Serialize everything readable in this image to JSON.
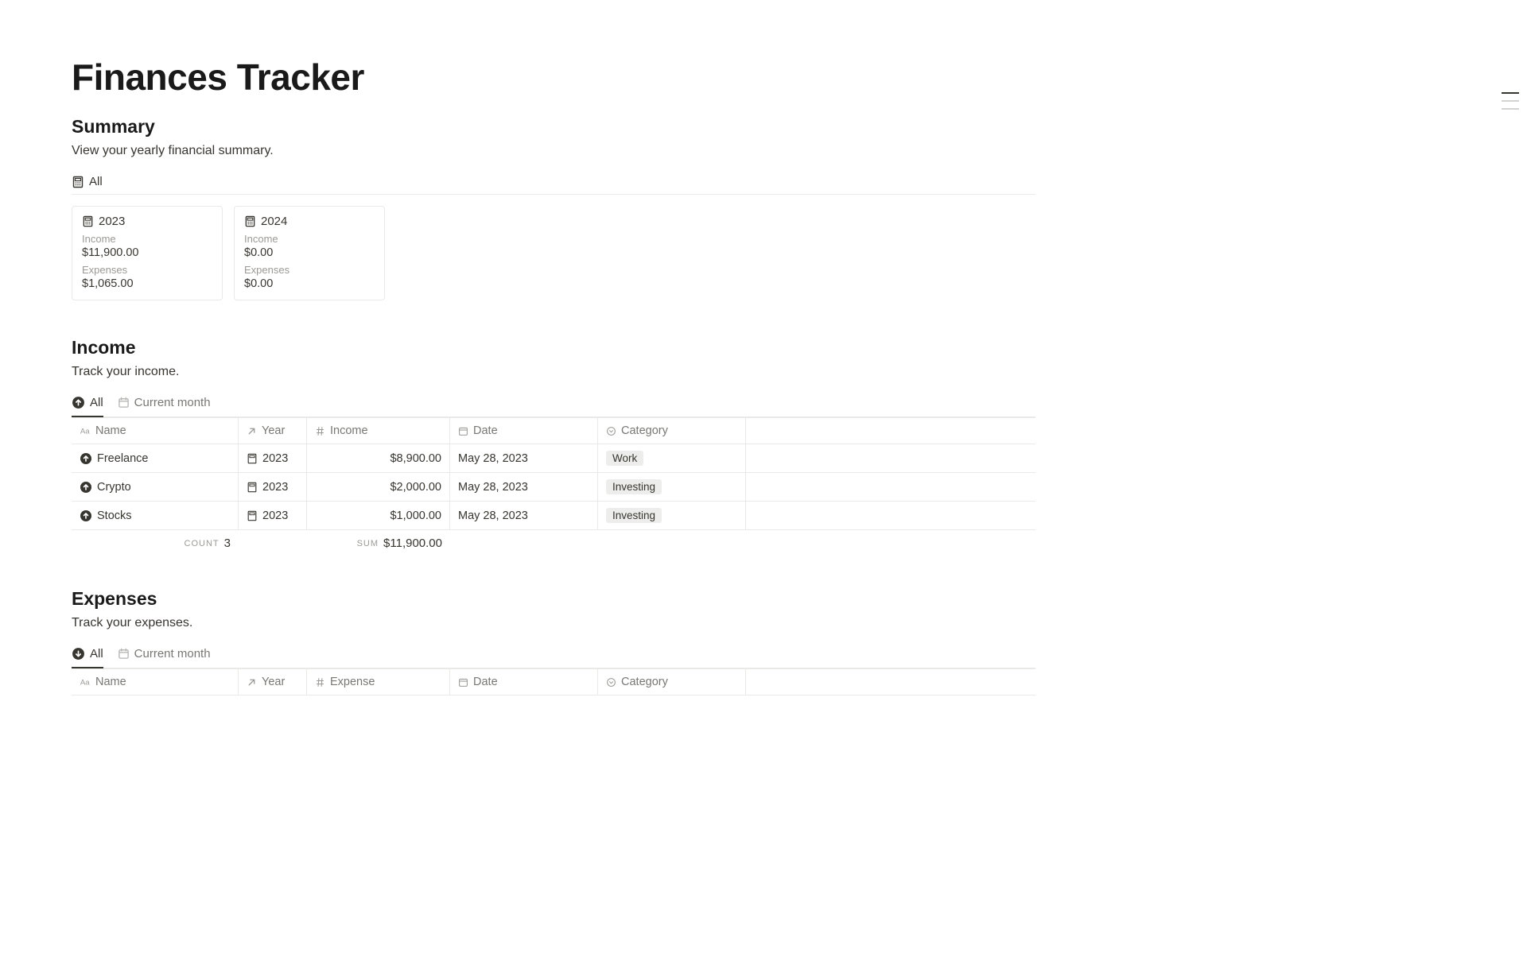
{
  "page": {
    "title": "Finances Tracker"
  },
  "summary": {
    "heading": "Summary",
    "description": "View your yearly financial summary.",
    "tab_all": "All",
    "cards": [
      {
        "year": "2023",
        "income_label": "Income",
        "income_value": "$11,900.00",
        "expenses_label": "Expenses",
        "expenses_value": "$1,065.00"
      },
      {
        "year": "2024",
        "income_label": "Income",
        "income_value": "$0.00",
        "expenses_label": "Expenses",
        "expenses_value": "$0.00"
      }
    ]
  },
  "income": {
    "heading": "Income",
    "description": "Track your income.",
    "tabs": {
      "all": "All",
      "current": "Current month"
    },
    "columns": {
      "name": "Name",
      "year": "Year",
      "amount": "Income",
      "date": "Date",
      "category": "Category"
    },
    "rows": [
      {
        "name": "Freelance",
        "year": "2023",
        "amount": "$8,900.00",
        "date": "May 28, 2023",
        "category": "Work"
      },
      {
        "name": "Crypto",
        "year": "2023",
        "amount": "$2,000.00",
        "date": "May 28, 2023",
        "category": "Investing"
      },
      {
        "name": "Stocks",
        "year": "2023",
        "amount": "$1,000.00",
        "date": "May 28, 2023",
        "category": "Investing"
      }
    ],
    "footer": {
      "count_label": "COUNT",
      "count_value": "3",
      "sum_label": "SUM",
      "sum_value": "$11,900.00"
    }
  },
  "expenses": {
    "heading": "Expenses",
    "description": "Track your expenses.",
    "tabs": {
      "all": "All",
      "current": "Current month"
    },
    "columns": {
      "name": "Name",
      "year": "Year",
      "amount": "Expense",
      "date": "Date",
      "category": "Category"
    }
  }
}
